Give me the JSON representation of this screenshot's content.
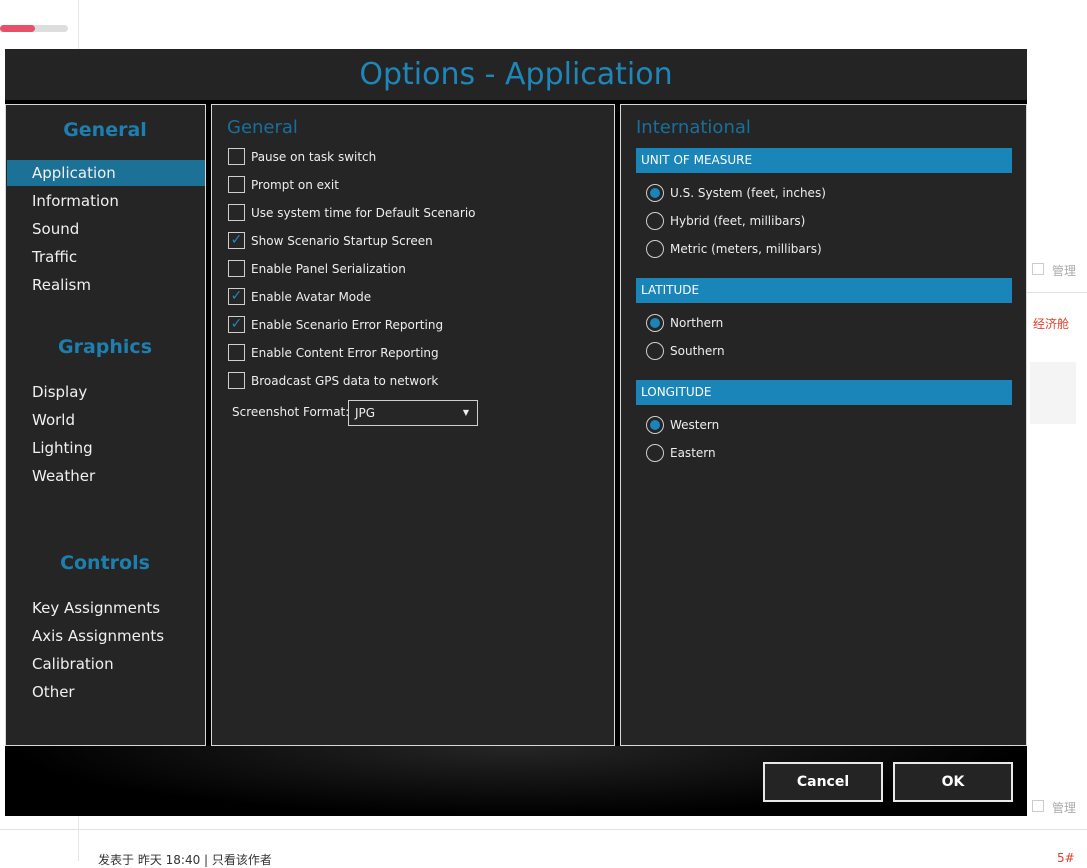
{
  "background": {
    "right_labels": [
      "管理",
      "管理"
    ],
    "red_label": "经济舱",
    "footer_text": "发表于 昨天 18:40 | 只看该作者",
    "corner": "5#"
  },
  "dialog": {
    "title": "Options - Application",
    "sidebar": {
      "sections": [
        {
          "heading": "General",
          "items": [
            "Application",
            "Information",
            "Sound",
            "Traffic",
            "Realism"
          ]
        },
        {
          "heading": "Graphics",
          "items": [
            "Display",
            "World",
            "Lighting",
            "Weather"
          ]
        },
        {
          "heading": "Controls",
          "items": [
            "Key Assignments",
            "Axis Assignments",
            "Calibration",
            "Other"
          ]
        }
      ],
      "selected": "Application"
    },
    "general": {
      "heading": "General",
      "checkboxes": [
        {
          "label": "Pause on task switch",
          "checked": false
        },
        {
          "label": "Prompt on exit",
          "checked": false
        },
        {
          "label": "Use system time for Default Scenario",
          "checked": false
        },
        {
          "label": "Show Scenario Startup Screen",
          "checked": true
        },
        {
          "label": "Enable Panel Serialization",
          "checked": false
        },
        {
          "label": "Enable Avatar Mode",
          "checked": true
        },
        {
          "label": "Enable Scenario Error Reporting",
          "checked": true
        },
        {
          "label": "Enable Content Error Reporting",
          "checked": false
        },
        {
          "label": "Broadcast GPS data to network",
          "checked": false
        }
      ],
      "screenshot_format_label": "Screenshot Format:",
      "screenshot_format": "JPG"
    },
    "international": {
      "heading": "International",
      "groups": [
        {
          "title": "UNIT OF MEASURE",
          "options": [
            "U.S. System (feet, inches)",
            "Hybrid (feet, millibars)",
            "Metric (meters, millibars)"
          ],
          "selected": 0
        },
        {
          "title": "LATITUDE",
          "options": [
            "Northern",
            "Southern"
          ],
          "selected": 0
        },
        {
          "title": "LONGITUDE",
          "options": [
            "Western",
            "Eastern"
          ],
          "selected": 0
        }
      ]
    },
    "buttons": {
      "cancel": "Cancel",
      "ok": "OK"
    },
    "accent": "#1a85b8"
  }
}
